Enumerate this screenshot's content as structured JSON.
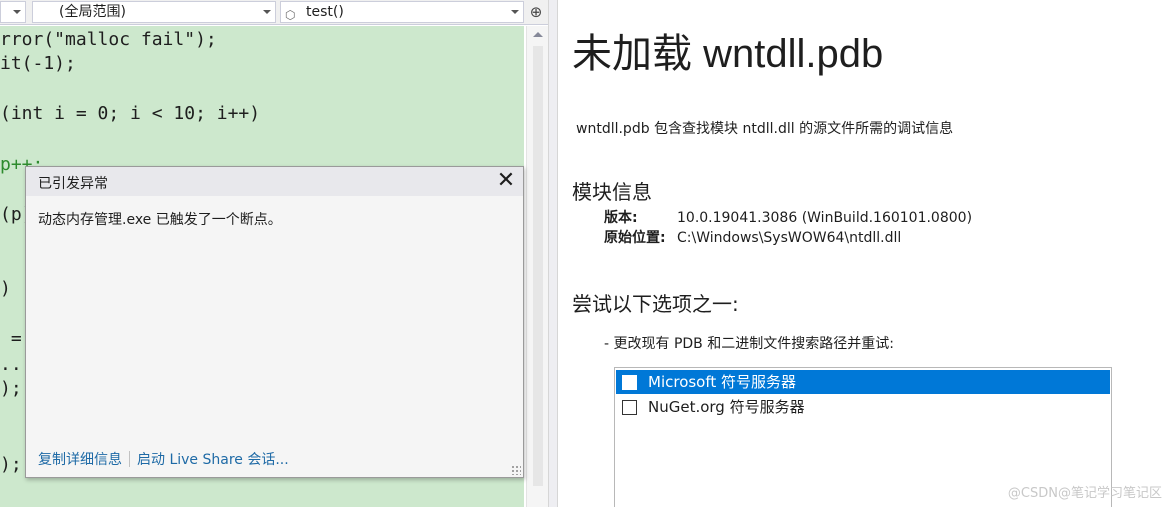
{
  "navbar": {
    "scope_label": "(全局范围)",
    "member_label": "test()"
  },
  "code_lines": [
    {
      "text": "rror(\"malloc fail\");",
      "green": false
    },
    {
      "text": "it(-1);",
      "green": false
    },
    {
      "text": "",
      "green": false
    },
    {
      "text": "(int i = 0; i < 10; i++)",
      "green": false
    },
    {
      "text": "",
      "green": false
    },
    {
      "text": "p++;",
      "green": true
    },
    {
      "text": "",
      "green": false
    },
    {
      "text": "(p)",
      "green": false
    },
    {
      "text": "",
      "green": false
    },
    {
      "text": "",
      "green": false
    },
    {
      "text": ")",
      "green": false
    },
    {
      "text": "",
      "green": false
    },
    {
      "text": " =",
      "green": false
    },
    {
      "text": "..",
      "green": false
    },
    {
      "text": ");",
      "green": false
    },
    {
      "text": "",
      "green": false
    },
    {
      "text": "",
      "green": false
    },
    {
      "text": ");",
      "green": false
    }
  ],
  "exception": {
    "title": "已引发异常",
    "close_glyph": "✕",
    "message": "动态内存管理.exe 已触发了一个断点。",
    "copy_details_link": "复制详细信息",
    "live_share_link": "启动 Live Share 会话..."
  },
  "doc": {
    "title": "未加载 wntdll.pdb",
    "description": "wntdll.pdb 包含查找模块 ntdll.dll 的源文件所需的调试信息",
    "module_section": "模块信息",
    "version_label": "版本:",
    "version_value": "10.0.19041.3086 (WinBuild.160101.0800)",
    "path_label": "原始位置:",
    "path_value": "C:\\Windows\\SysWOW64\\ntdll.dll",
    "try_section": "尝试以下选项之一:",
    "option1": "-  更改现有 PDB 和二进制文件搜索路径并重试:",
    "symbol_servers": [
      {
        "label": "Microsoft 符号服务器",
        "checked": false,
        "selected": true
      },
      {
        "label": "NuGet.org 符号服务器",
        "checked": false,
        "selected": false
      }
    ]
  },
  "watermark": "@CSDN@笔记学习笔记区",
  "colors": {
    "code_background": "#cde8cd",
    "selection": "#0078d7",
    "link": "#1e6aa6"
  }
}
